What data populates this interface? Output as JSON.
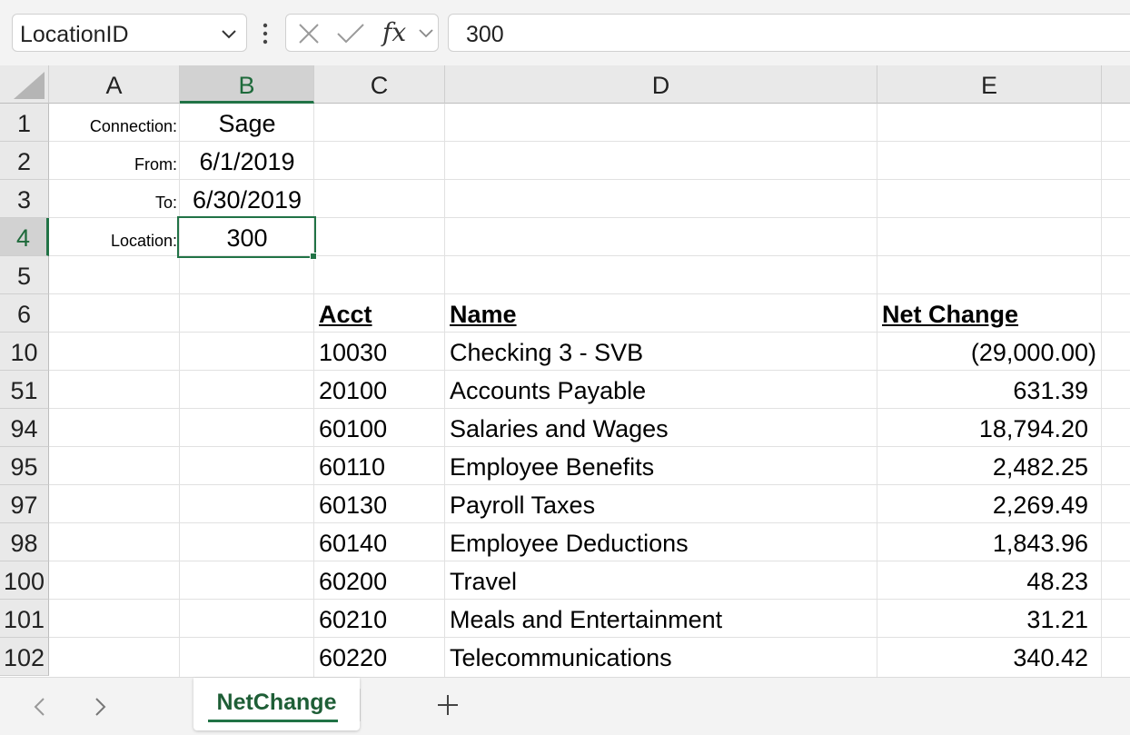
{
  "formula_bar": {
    "name_box": "LocationID",
    "fx_label": "fx",
    "formula": "300"
  },
  "columns": [
    {
      "label": "A"
    },
    {
      "label": "B"
    },
    {
      "label": "C"
    },
    {
      "label": "D"
    },
    {
      "label": "E"
    }
  ],
  "rows": [
    {
      "num": "1",
      "a": "Connection:",
      "b": "Sage",
      "c": "",
      "d": "",
      "e": ""
    },
    {
      "num": "2",
      "a": "From:",
      "b": "6/1/2019",
      "c": "",
      "d": "",
      "e": ""
    },
    {
      "num": "3",
      "a": "To:",
      "b": "6/30/2019",
      "c": "",
      "d": "",
      "e": ""
    },
    {
      "num": "4",
      "a": "Location:",
      "b": "300",
      "c": "",
      "d": "",
      "e": ""
    },
    {
      "num": "5",
      "a": "",
      "b": "",
      "c": "",
      "d": "",
      "e": ""
    },
    {
      "num": "6",
      "a": "",
      "b": "",
      "c": "Acct",
      "d": "Name",
      "e": "Net Change"
    },
    {
      "num": "10",
      "a": "",
      "b": "",
      "c": "10030",
      "d": "Checking 3 - SVB",
      "e": "(29,000.00)"
    },
    {
      "num": "51",
      "a": "",
      "b": "",
      "c": "20100",
      "d": "Accounts Payable",
      "e": "631.39"
    },
    {
      "num": "94",
      "a": "",
      "b": "",
      "c": "60100",
      "d": "Salaries and Wages",
      "e": "18,794.20"
    },
    {
      "num": "95",
      "a": "",
      "b": "",
      "c": "60110",
      "d": "Employee Benefits",
      "e": "2,482.25"
    },
    {
      "num": "97",
      "a": "",
      "b": "",
      "c": "60130",
      "d": "Payroll Taxes",
      "e": "2,269.49"
    },
    {
      "num": "98",
      "a": "",
      "b": "",
      "c": "60140",
      "d": "Employee Deductions",
      "e": "1,843.96"
    },
    {
      "num": "100",
      "a": "",
      "b": "",
      "c": "60200",
      "d": "Travel",
      "e": "48.23"
    },
    {
      "num": "101",
      "a": "",
      "b": "",
      "c": "60210",
      "d": "Meals and Entertainment",
      "e": "31.21"
    },
    {
      "num": "102",
      "a": "",
      "b": "",
      "c": "60220",
      "d": "Telecommunications",
      "e": "340.42"
    }
  ],
  "active_cell": {
    "column": "B",
    "row": "4"
  },
  "sheet_tabs": {
    "active": "NetChange",
    "add_label": "+"
  },
  "colors": {
    "accent": "#217346",
    "header_bg": "#e9e9e9",
    "selected_header_bg": "#d2d2d2"
  }
}
